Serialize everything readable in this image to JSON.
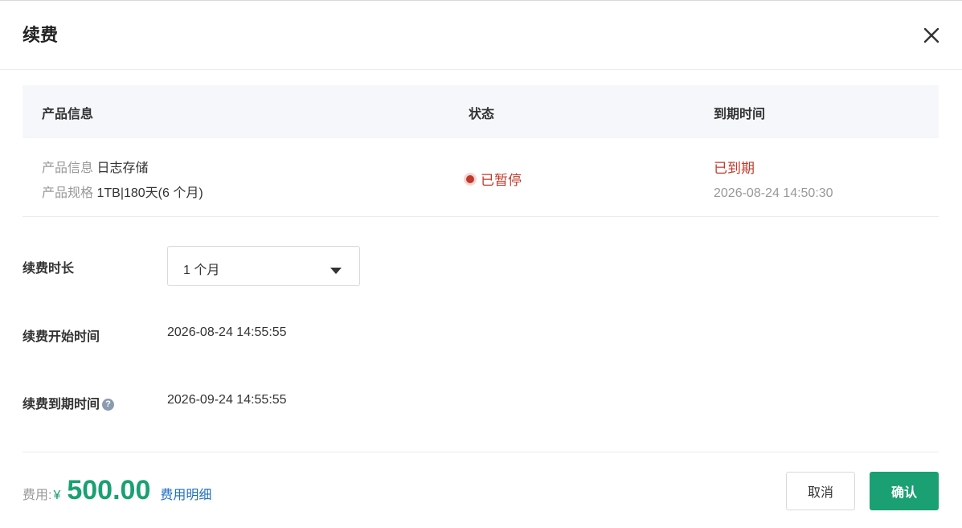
{
  "dialog": {
    "title": "续费",
    "close_icon": "close-icon"
  },
  "table": {
    "headers": [
      "产品信息",
      "状态",
      "到期时间"
    ],
    "row": {
      "product_label": "产品信息",
      "product_value": "日志存储",
      "spec_label": "产品规格",
      "spec_value": "1TB|180天(6 个月)",
      "status": "已暂停",
      "expire_status": "已到期",
      "expire_time": "2026-08-24 14:50:30"
    }
  },
  "form": {
    "duration_label": "续费时长",
    "duration_value": "1 个月",
    "start_label": "续费开始时间",
    "start_value": "2026-08-24 14:55:55",
    "end_label": "续费到期时间",
    "end_help": "?",
    "end_value": "2026-09-24 14:55:55"
  },
  "footer": {
    "fee_label": "费用:",
    "currency": "¥",
    "amount": "500.00",
    "detail_link": "费用明细",
    "cancel_label": "取消",
    "confirm_label": "确认"
  },
  "colors": {
    "primary": "#1aa073",
    "danger": "#c0392b",
    "link": "#1e6fc0"
  }
}
